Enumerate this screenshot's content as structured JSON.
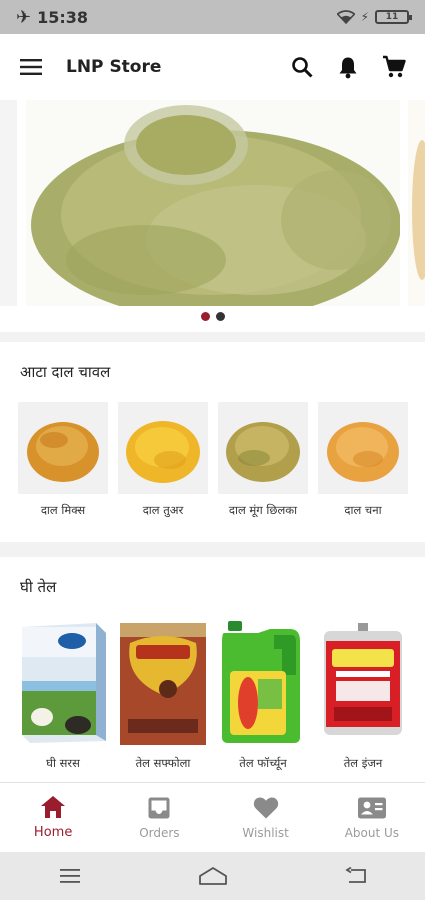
{
  "status_bar": {
    "time": "15:38",
    "battery": "11"
  },
  "app_bar": {
    "title": "LNP Store"
  },
  "banner": {
    "slides": 2,
    "active_index": 0
  },
  "sections": [
    {
      "title": "आटा दाल चावल",
      "products": [
        {
          "name": "दाल मिक्स"
        },
        {
          "name": "दाल तुअर"
        },
        {
          "name": "दाल मूंग छिलका"
        },
        {
          "name": "दाल चना"
        }
      ]
    },
    {
      "title": "घी तेल",
      "products": [
        {
          "name": "घी सरस"
        },
        {
          "name": "तेल सफ्फोला"
        },
        {
          "name": "तेल फॉर्च्यून"
        },
        {
          "name": "तेल इंजन"
        }
      ]
    }
  ],
  "bottom_nav": [
    {
      "label": "Home",
      "icon": "home-icon",
      "active": true
    },
    {
      "label": "Orders",
      "icon": "inbox-icon",
      "active": false
    },
    {
      "label": "Wishlist",
      "icon": "heart-icon",
      "active": false
    },
    {
      "label": "About Us",
      "icon": "contact-card-icon",
      "active": false
    }
  ],
  "colors": {
    "accent": "#9a1d2e",
    "inactive": "#9b9b9b"
  }
}
